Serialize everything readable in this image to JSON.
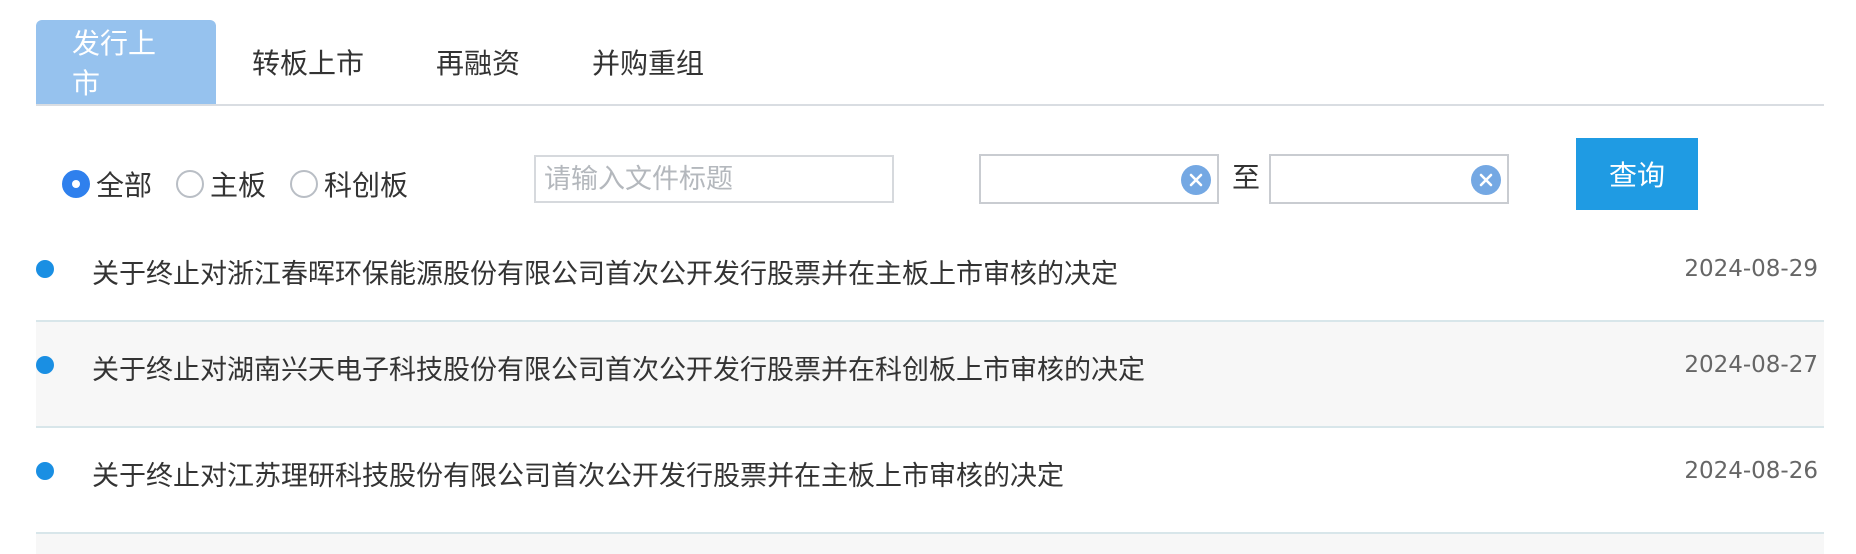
{
  "tabs": [
    {
      "label": "发行上市",
      "active": true
    },
    {
      "label": "转板上市",
      "active": false
    },
    {
      "label": "再融资",
      "active": false
    },
    {
      "label": "并购重组",
      "active": false
    }
  ],
  "filters": {
    "radios": [
      {
        "label": "全部",
        "checked": true
      },
      {
        "label": "主板",
        "checked": false
      },
      {
        "label": "科创板",
        "checked": false
      }
    ],
    "title_placeholder": "请输入文件标题",
    "date_from": "",
    "date_to": "",
    "to_label": "至",
    "search_label": "查询"
  },
  "list": [
    {
      "title": "关于终止对浙江春晖环保能源股份有限公司首次公开发行股票并在主板上市审核的决定",
      "date": "2024-08-29"
    },
    {
      "title": "关于终止对湖南兴天电子科技股份有限公司首次公开发行股票并在科创板上市审核的决定",
      "date": "2024-08-27"
    },
    {
      "title": "关于终止对江苏理研科技股份有限公司首次公开发行股票并在主板上市审核的决定",
      "date": "2024-08-26"
    }
  ],
  "colors": {
    "tab_active": "#96c2ee",
    "accent_blue": "#1f9be3",
    "bullet": "#1a8fe3"
  },
  "icons": {
    "clear": "close-circle-icon",
    "bullet": "dot-icon"
  }
}
